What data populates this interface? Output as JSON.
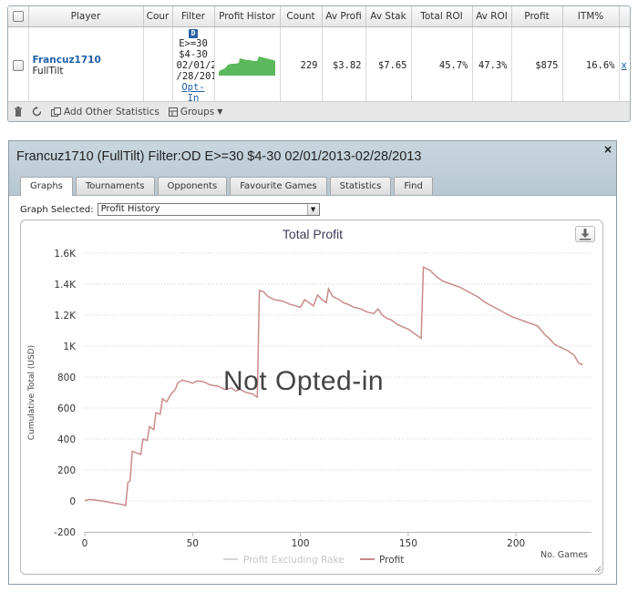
{
  "stats": {
    "headers": [
      "",
      "Player",
      "Cour",
      "Filter",
      "Profit Histor",
      "Count",
      "Av Profi",
      "Av Stak",
      "Total ROI",
      "Av ROI",
      "Profit",
      "ITM%",
      ""
    ],
    "row": {
      "player_name": "Francuz1710",
      "site": "FullTilt",
      "filter_badge": "D",
      "filter_lines": [
        "E>=30",
        "$4-30",
        "02/01/2",
        "/28/201"
      ],
      "filter_link": "Opt-In",
      "count": "229",
      "av_profit": "$3.82",
      "av_stake": "$7.65",
      "total_roi": "45.7%",
      "av_roi": "47.3%",
      "profit": "$875",
      "itm": "16.6%",
      "remove": "x"
    },
    "toolbar": {
      "add_stats": "Add Other Statistics",
      "groups": "Groups"
    }
  },
  "graph_window": {
    "title": "Francuz1710 (FullTilt) Filter:OD E>=30 $4-30 02/01/2013-02/28/2013",
    "tabs": [
      "Graphs",
      "Tournaments",
      "Opponents",
      "Favourite Games",
      "Statistics",
      "Find"
    ],
    "active_tab": "Graphs",
    "graph_selected_label": "Graph Selected:",
    "graph_selected_value": "Profit History",
    "watermark": "Not Opted-in"
  },
  "colors": {
    "profit_line": "#c98b8b",
    "excl_rake_line": "#d6d6d6",
    "sparkline": "#5cb85c",
    "link": "#1f5fa8"
  },
  "chart_data": {
    "type": "line",
    "title": "Total Profit",
    "xlabel": "No. Games",
    "ylabel": "Cumulative Total (USD)",
    "xlim": [
      0,
      235
    ],
    "ylim": [
      -200,
      1600
    ],
    "x_ticks": [
      0,
      50,
      100,
      150,
      200
    ],
    "x_tick_labels": [
      "0",
      "50",
      "100",
      "150",
      "200"
    ],
    "y_ticks": [
      -200,
      0,
      200,
      400,
      600,
      800,
      1000,
      1200,
      1400,
      1600
    ],
    "y_tick_labels": [
      "-200",
      "0",
      "200",
      "400",
      "600",
      "800",
      "1K",
      "1.2K",
      "1.4K",
      "1.6K"
    ],
    "grid": true,
    "legend": "bottom-center",
    "series": [
      {
        "name": "Profit Excluding Rake",
        "points": []
      },
      {
        "name": "Profit",
        "points": [
          [
            0,
            0
          ],
          [
            2,
            10
          ],
          [
            5,
            5
          ],
          [
            8,
            0
          ],
          [
            10,
            -5
          ],
          [
            12,
            -10
          ],
          [
            14,
            -15
          ],
          [
            16,
            -20
          ],
          [
            18,
            -25
          ],
          [
            19,
            -30
          ],
          [
            20,
            120
          ],
          [
            21,
            130
          ],
          [
            22,
            320
          ],
          [
            24,
            310
          ],
          [
            26,
            300
          ],
          [
            27,
            400
          ],
          [
            29,
            390
          ],
          [
            30,
            480
          ],
          [
            32,
            460
          ],
          [
            33,
            570
          ],
          [
            35,
            560
          ],
          [
            36,
            660
          ],
          [
            38,
            640
          ],
          [
            40,
            690
          ],
          [
            42,
            720
          ],
          [
            43,
            760
          ],
          [
            45,
            780
          ],
          [
            48,
            770
          ],
          [
            50,
            760
          ],
          [
            52,
            775
          ],
          [
            55,
            770
          ],
          [
            58,
            750
          ],
          [
            62,
            740
          ],
          [
            65,
            720
          ],
          [
            68,
            730
          ],
          [
            70,
            710
          ],
          [
            72,
            720
          ],
          [
            75,
            700
          ],
          [
            78,
            690
          ],
          [
            80,
            670
          ],
          [
            81,
            1360
          ],
          [
            83,
            1350
          ],
          [
            85,
            1320
          ],
          [
            88,
            1300
          ],
          [
            92,
            1290
          ],
          [
            95,
            1270
          ],
          [
            98,
            1260
          ],
          [
            100,
            1250
          ],
          [
            102,
            1300
          ],
          [
            104,
            1280
          ],
          [
            106,
            1260
          ],
          [
            108,
            1330
          ],
          [
            110,
            1300
          ],
          [
            112,
            1280
          ],
          [
            113,
            1370
          ],
          [
            115,
            1320
          ],
          [
            118,
            1300
          ],
          [
            120,
            1280
          ],
          [
            122,
            1270
          ],
          [
            125,
            1250
          ],
          [
            128,
            1240
          ],
          [
            131,
            1220
          ],
          [
            134,
            1210
          ],
          [
            136,
            1240
          ],
          [
            138,
            1200
          ],
          [
            140,
            1180
          ],
          [
            142,
            1170
          ],
          [
            145,
            1140
          ],
          [
            148,
            1120
          ],
          [
            150,
            1110
          ],
          [
            153,
            1080
          ],
          [
            155,
            1060
          ],
          [
            156,
            1050
          ],
          [
            157,
            1510
          ],
          [
            160,
            1490
          ],
          [
            163,
            1450
          ],
          [
            166,
            1420
          ],
          [
            170,
            1400
          ],
          [
            174,
            1380
          ],
          [
            178,
            1350
          ],
          [
            182,
            1320
          ],
          [
            186,
            1280
          ],
          [
            190,
            1250
          ],
          [
            194,
            1220
          ],
          [
            198,
            1190
          ],
          [
            202,
            1170
          ],
          [
            206,
            1150
          ],
          [
            210,
            1130
          ],
          [
            213,
            1080
          ],
          [
            216,
            1040
          ],
          [
            218,
            1010
          ],
          [
            221,
            990
          ],
          [
            224,
            970
          ],
          [
            227,
            940
          ],
          [
            229,
            890
          ],
          [
            231,
            880
          ]
        ]
      }
    ]
  }
}
